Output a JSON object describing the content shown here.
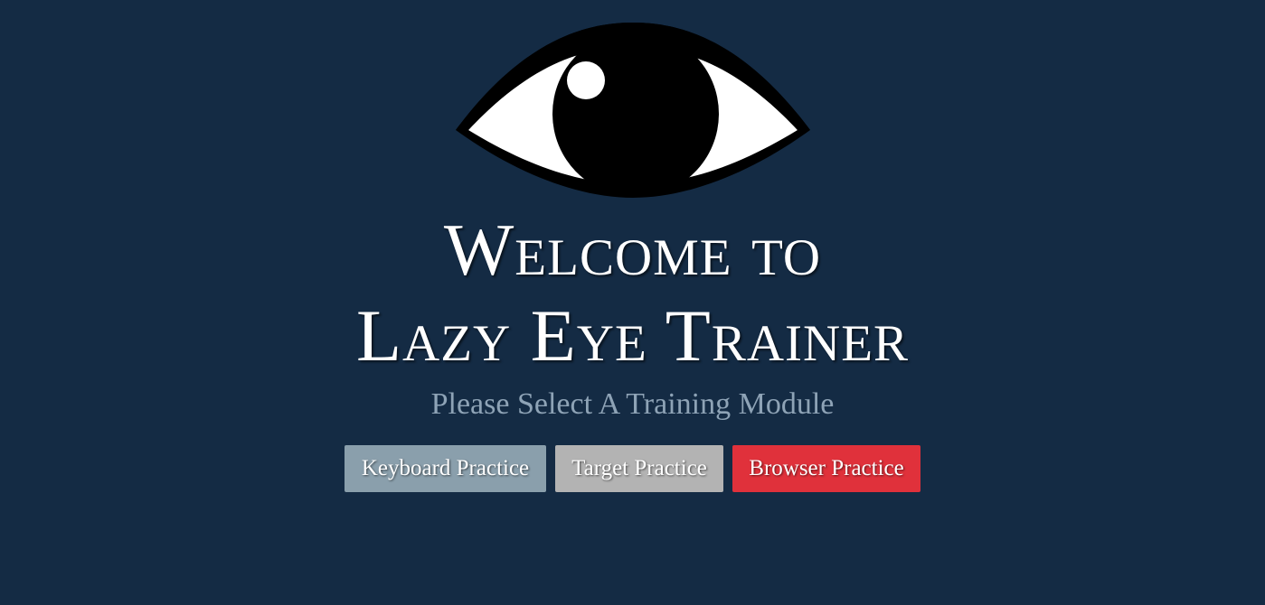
{
  "logo": {
    "icon": "eye-icon"
  },
  "heading": {
    "line1": "Welcome to",
    "line2": "Lazy Eye Trainer"
  },
  "subtitle": "Please Select A Training Module",
  "buttons": [
    {
      "label": "Keyboard Practice",
      "color": "#8a9fac"
    },
    {
      "label": "Target Practice",
      "color": "#b3b3b3"
    },
    {
      "label": "Browser Practice",
      "color": "#e0313b"
    }
  ],
  "colors": {
    "background": "#142b44",
    "title": "#ffffff",
    "subtitle": "#8ea3b6"
  }
}
